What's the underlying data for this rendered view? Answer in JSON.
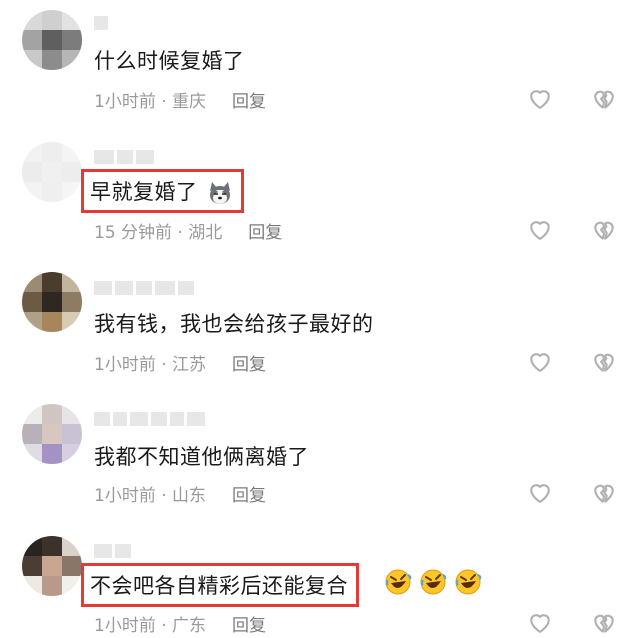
{
  "comments": [
    {
      "text": "什么时候复婚了",
      "time": "1小时前",
      "location": "重庆",
      "reply": "回复",
      "highlighted": false
    },
    {
      "text": "早就复婚了",
      "time": "15 分钟前",
      "location": "湖北",
      "reply": "回复",
      "highlighted": true,
      "emoji": "husky-dog-emoji"
    },
    {
      "text": "我有钱，我也会给孩子最好的",
      "time": "1小时前",
      "location": "江苏",
      "reply": "回复",
      "highlighted": false
    },
    {
      "text": "我都不知道他俩离婚了",
      "time": "1小时前",
      "location": "山东",
      "reply": "回复",
      "highlighted": false
    },
    {
      "text": "不会吧各自精彩后还能复合",
      "time": "1小时前",
      "location": "广东",
      "reply": "回复",
      "highlighted": true,
      "emoji": "rolling-laughing-emoji x3"
    }
  ],
  "separator": " · ",
  "icons": {
    "like": "heart-outline-icon",
    "dislike": "broken-heart-icon"
  },
  "colors": {
    "highlight_box": "#e53935",
    "meta_text": "#9a9a9a",
    "icon": "#b0b0b0"
  }
}
